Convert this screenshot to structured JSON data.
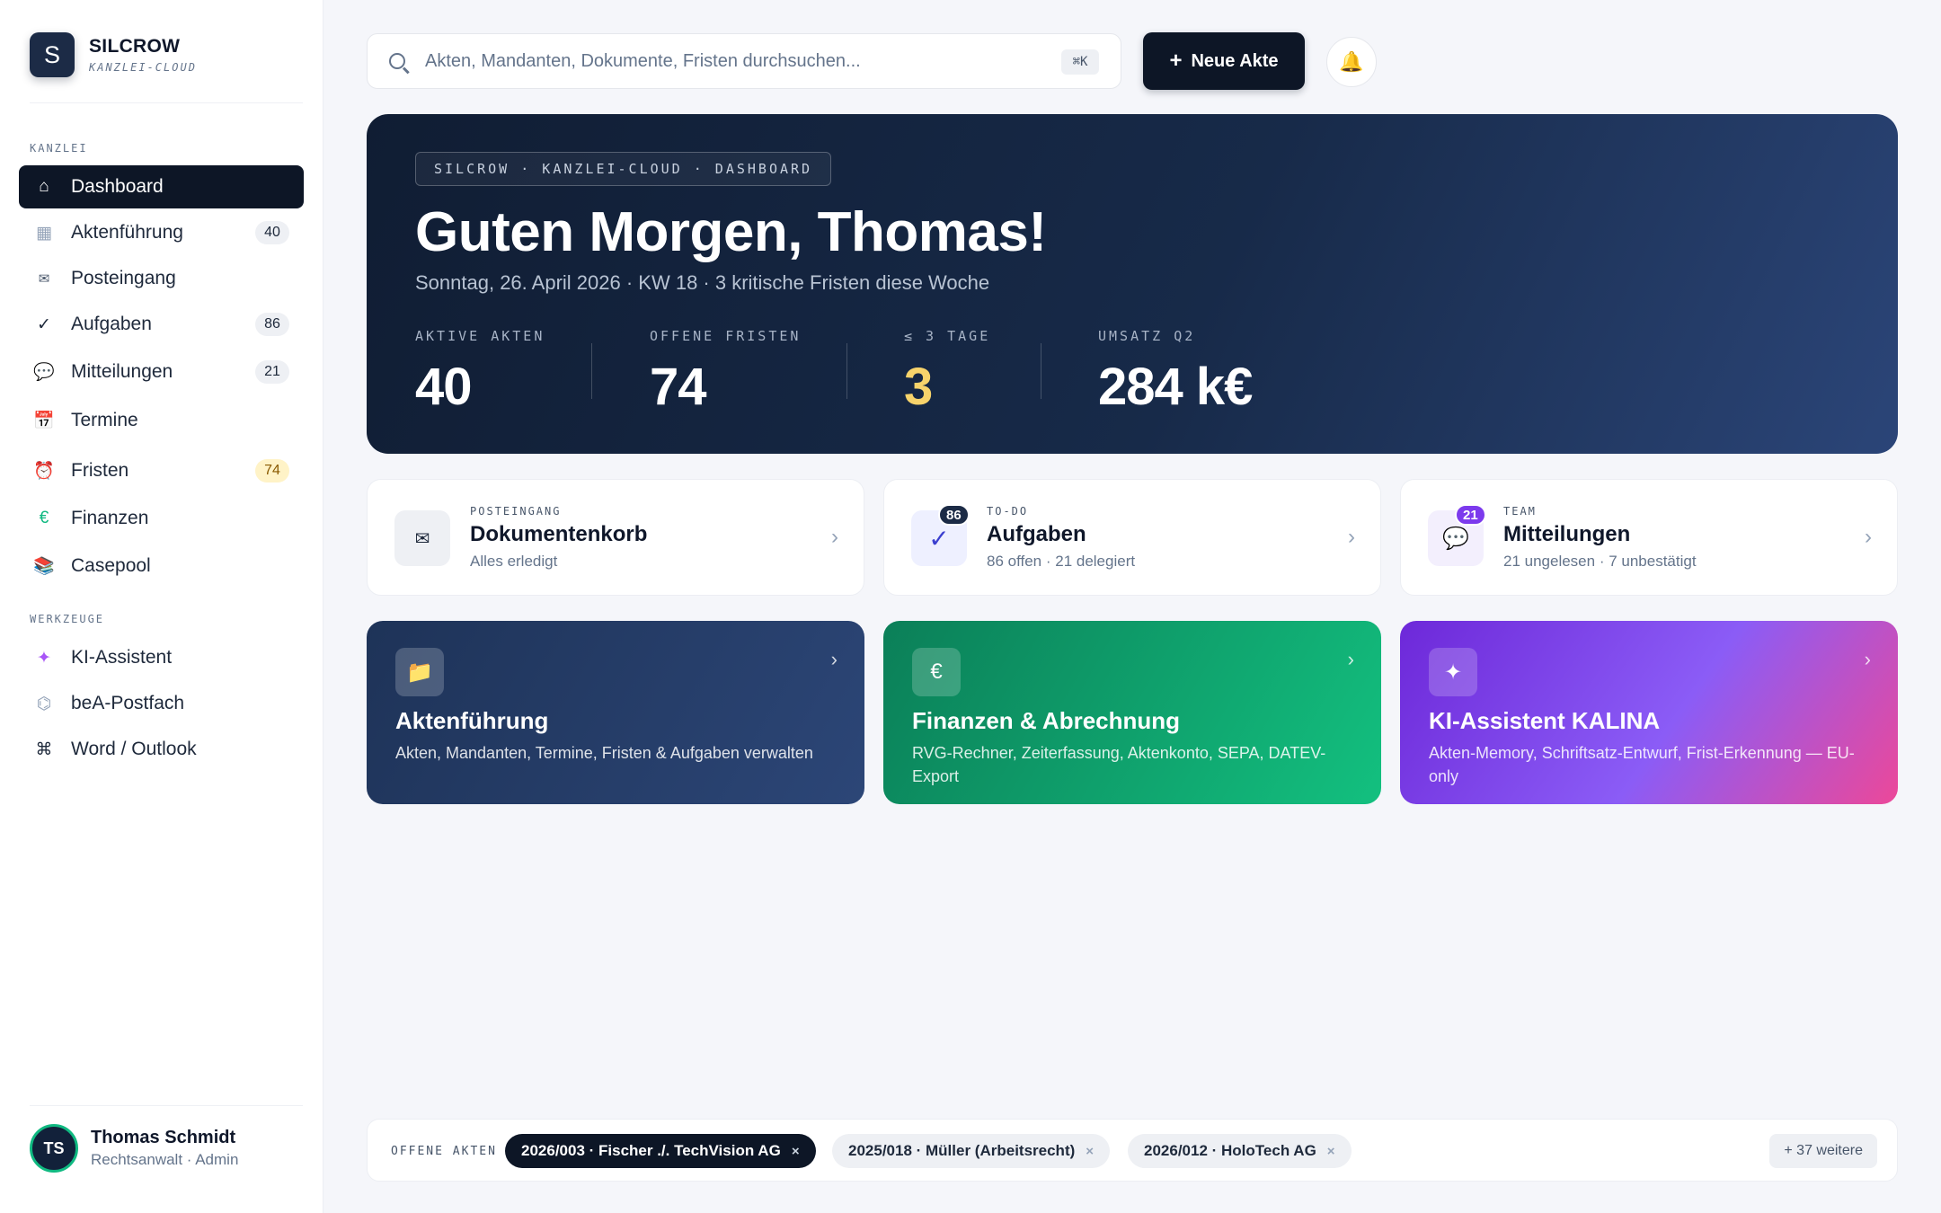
{
  "brand": {
    "initial": "S",
    "name": "SILCROW",
    "subtitle": "KANZLEI-CLOUD"
  },
  "sidebar": {
    "section_kanzlei": "KANZLEI",
    "section_werkzeuge": "WERKZEUGE",
    "items": [
      {
        "label": "Dashboard",
        "icon": "⌂",
        "icon_name": "home-icon",
        "badge": "",
        "active": true
      },
      {
        "label": "Aktenführung",
        "icon": "▦",
        "icon_name": "files-icon",
        "badge": "40"
      },
      {
        "label": "Posteingang",
        "icon": "✉",
        "icon_name": "envelope-icon",
        "badge": ""
      },
      {
        "label": "Aufgaben",
        "icon": "✓",
        "icon_name": "check-icon",
        "badge": "86"
      },
      {
        "label": "Mitteilungen",
        "icon": "💬",
        "icon_name": "speech-bubble-icon",
        "badge": "21"
      },
      {
        "label": "Termine",
        "icon": "📅",
        "icon_name": "calendar-icon",
        "badge": ""
      },
      {
        "label": "Fristen",
        "icon": "⏰",
        "icon_name": "alarm-clock-icon",
        "badge": "74",
        "badge_color": "#fff3c7"
      },
      {
        "label": "Finanzen",
        "icon": "€",
        "icon_name": "euro-icon",
        "badge": ""
      },
      {
        "label": "Casepool",
        "icon": "📚",
        "icon_name": "books-icon",
        "badge": ""
      }
    ],
    "tools": [
      {
        "label": "KI-Assistent",
        "icon": "✦",
        "icon_name": "sparkle-icon"
      },
      {
        "label": "beA-Postfach",
        "icon": "⌬",
        "icon_name": "mailbox-icon"
      },
      {
        "label": "Word / Outlook",
        "icon": "⌘",
        "icon_name": "command-icon"
      }
    ]
  },
  "user": {
    "initials": "TS",
    "name": "Thomas Schmidt",
    "role": "Rechtsanwalt · Admin"
  },
  "topbar": {
    "search_placeholder": "Akten, Mandanten, Dokumente, Fristen durchsuchen...",
    "shortcut": "⌘K",
    "new_label": "Neue Akte",
    "new_icon": "+",
    "bell_icon": "🔔"
  },
  "hero": {
    "chip": "SILCROW · KANZLEI-CLOUD · DASHBOARD",
    "greeting": "Guten Morgen, Thomas!",
    "subline": "Sonntag, 26. April 2026 · KW 18 · 3 kritische Fristen diese Woche",
    "stats": [
      {
        "label": "AKTIVE AKTEN",
        "value": "40"
      },
      {
        "label": "OFFENE FRISTEN",
        "value": "74"
      },
      {
        "label": "≤ 3 TAGE",
        "value": "3",
        "color": "#f7d36b"
      },
      {
        "label": "UMSATZ Q2",
        "value": "284 k€"
      }
    ]
  },
  "quick": [
    {
      "eyebrow": "POSTEINGANG",
      "title": "Dokumentenkorb",
      "sub": "Alles erledigt",
      "icon": "✉",
      "badge": ""
    },
    {
      "eyebrow": "TO-DO",
      "title": "Aufgaben",
      "sub": "86 offen · 21 delegiert",
      "icon": "✓",
      "badge": "86",
      "badge_color": "#1c2b46"
    },
    {
      "eyebrow": "TEAM",
      "title": "Mitteilungen",
      "sub": "21 ungelesen · 7 unbestätigt",
      "icon": "💬",
      "badge": "21",
      "badge_color": "#7c3aed"
    }
  ],
  "tiles": [
    {
      "title": "Aktenführung",
      "desc": "Akten, Mandanten, Termine, Fristen & Aufgaben verwalten",
      "icon": "📁",
      "colors": [
        "#1e3358",
        "#2c4677"
      ]
    },
    {
      "title": "Finanzen & Abrechnung",
      "desc": "RVG-Rechner, Zeiterfassung, Aktenkonto, SEPA, DATEV-Export",
      "icon": "€",
      "colors": [
        "#0b7f58",
        "#13c07f"
      ]
    },
    {
      "title": "KI-Assistent KALINA",
      "desc": "Akten-Memory, Schriftsatz-Entwurf, Frist-Erkennung — EU-only",
      "icon": "✦",
      "colors": [
        "#6d28d9",
        "#8b5cf6",
        "#ec4899"
      ]
    }
  ],
  "open_files": {
    "label": "OFFENE AKTEN",
    "chips": [
      {
        "label": "2026/003 · Fischer ./. TechVision AG",
        "active": true
      },
      {
        "label": "2025/018 · Müller (Arbeitsrecht)"
      },
      {
        "label": "2026/012 · HoloTech AG"
      }
    ],
    "close_icon": "×",
    "more": "+ 37 weitere"
  },
  "chevron": "›"
}
